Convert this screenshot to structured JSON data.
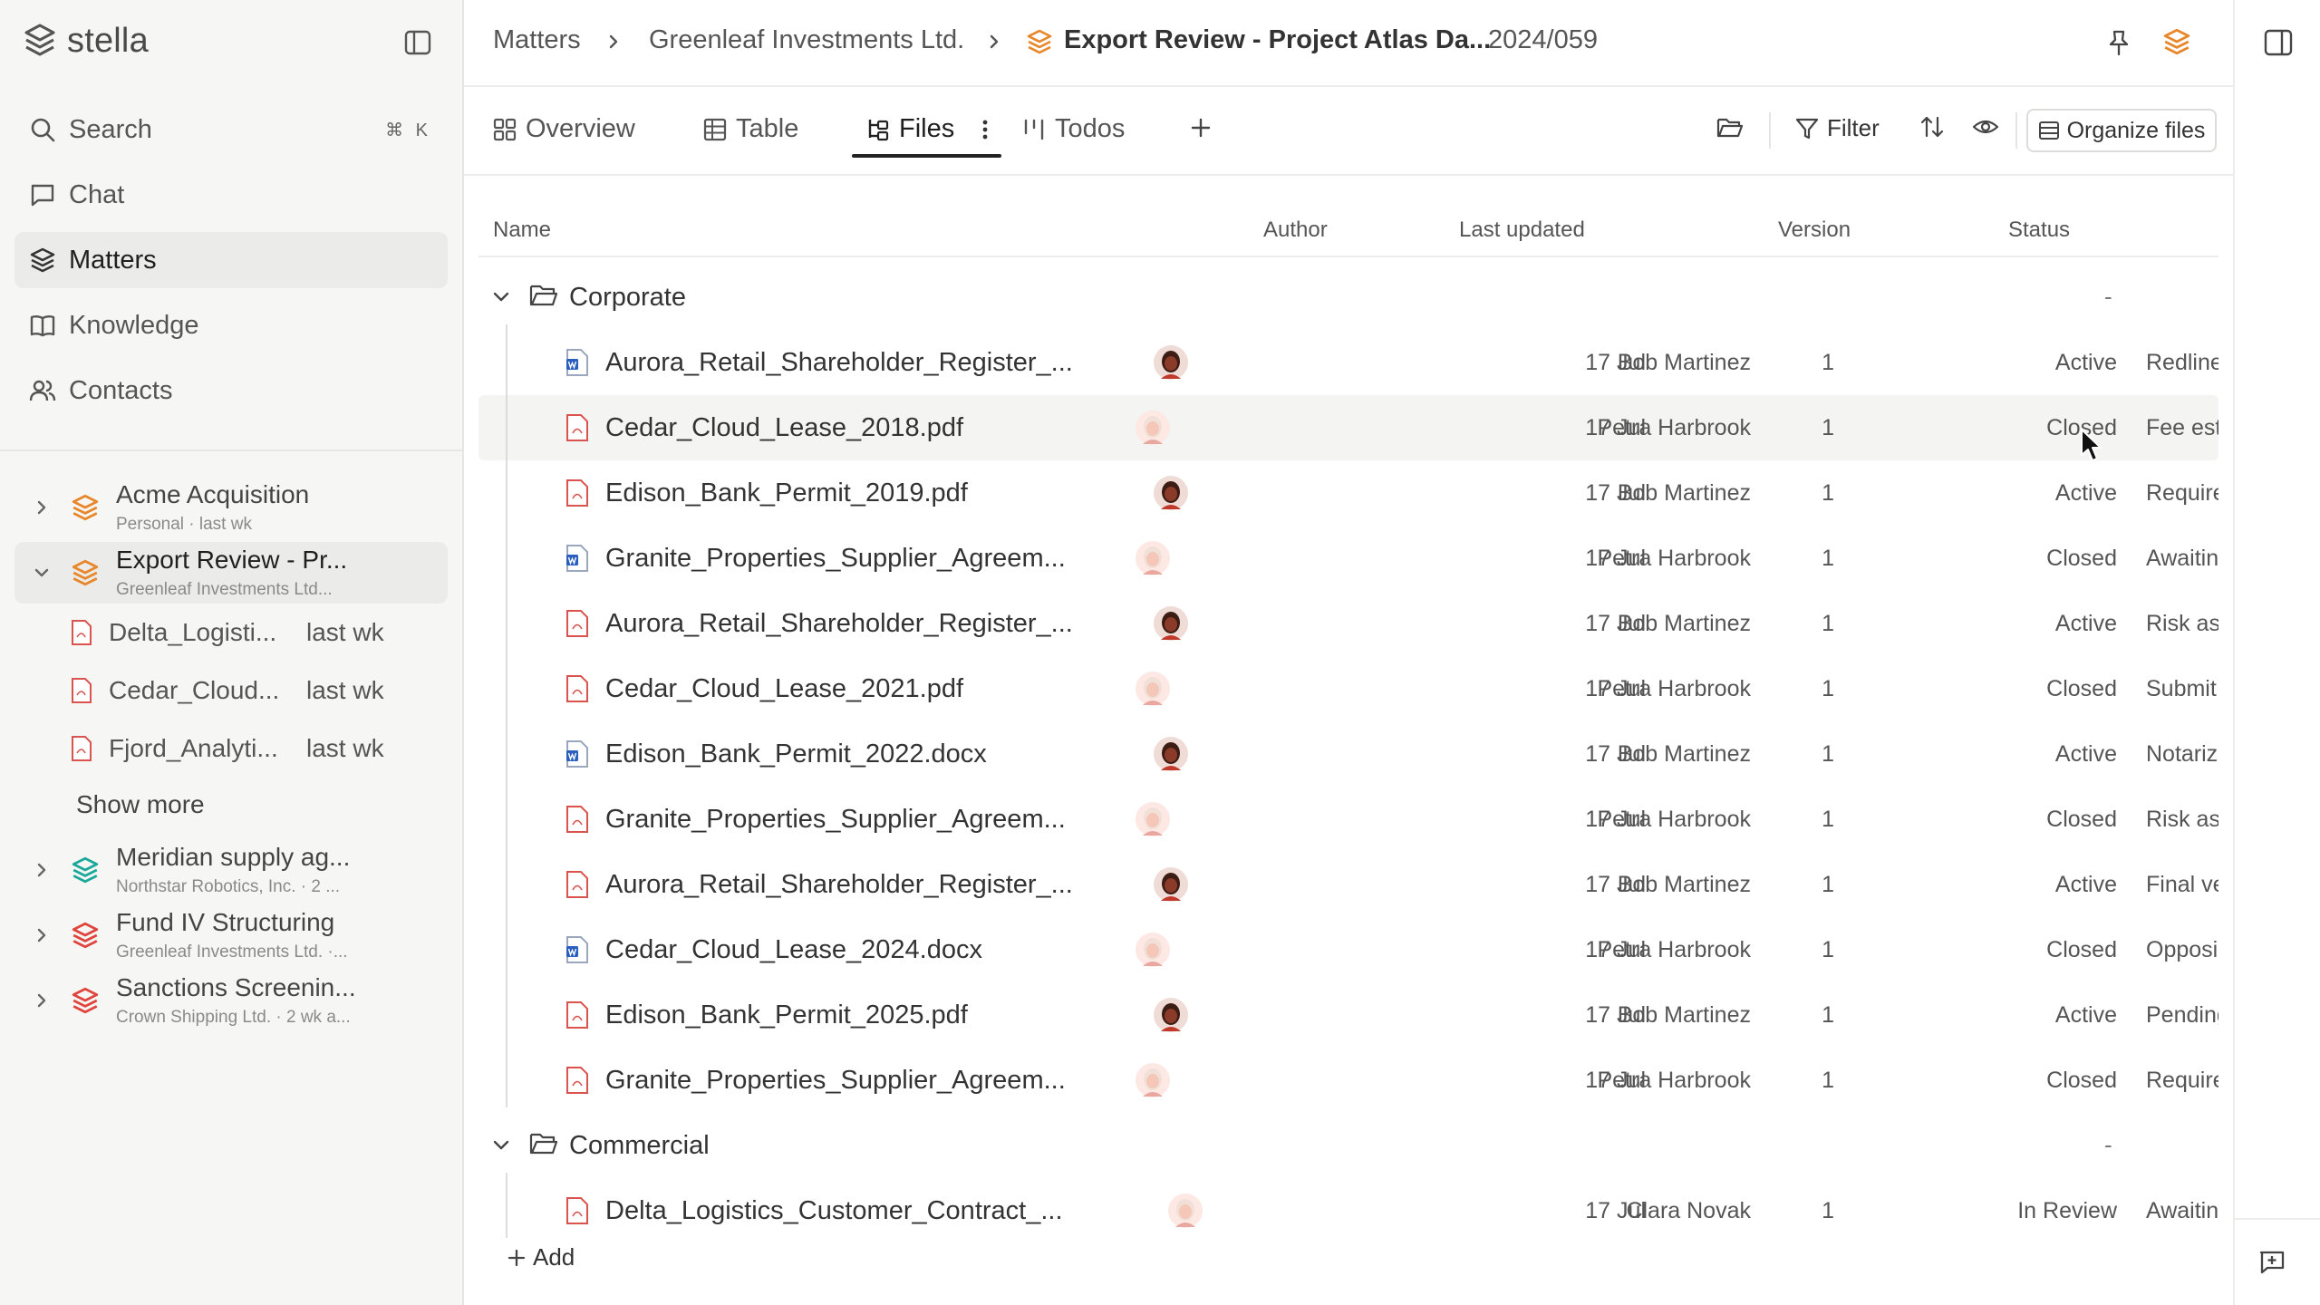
{
  "app": {
    "name": "stella"
  },
  "sidebar": {
    "nav": [
      {
        "label": "Search",
        "shortcut": "⌘ K",
        "icon": "search-icon"
      },
      {
        "label": "Chat",
        "icon": "chat-icon"
      },
      {
        "label": "Matters",
        "icon": "layers-icon"
      },
      {
        "label": "Knowledge",
        "icon": "book-icon"
      },
      {
        "label": "Contacts",
        "icon": "contacts-icon"
      }
    ],
    "matters": [
      {
        "title": "Acme Acquisition",
        "sub": "Personal · last wk",
        "color": "#e8862a"
      },
      {
        "title": "Export Review - Pr...",
        "sub": "Greenleaf Investments Ltd...",
        "color": "#e8862a"
      },
      {
        "title": "Meridian supply ag...",
        "sub": "Northstar Robotics, Inc. · 2 ...",
        "color": "#1aa89a"
      },
      {
        "title": "Fund IV Structuring",
        "sub": "Greenleaf Investments Ltd. ·...",
        "color": "#e0453d"
      },
      {
        "title": "Sanctions Screenin...",
        "sub": "Crown Shipping Ltd. · 2 wk a...",
        "color": "#e0453d"
      }
    ],
    "files": [
      {
        "name": "Delta_Logisti...",
        "time": "last wk"
      },
      {
        "name": "Cedar_Cloud...",
        "time": "last wk"
      },
      {
        "name": "Fjord_Analyti...",
        "time": "last wk"
      }
    ],
    "show_more": "Show more"
  },
  "breadcrumb": {
    "items": [
      "Matters",
      "Greenleaf Investments Ltd."
    ],
    "current": "Export Review - Project Atlas Da...",
    "code": "2024/059"
  },
  "tabs": [
    {
      "label": "Overview",
      "icon": "grid-icon"
    },
    {
      "label": "Table",
      "icon": "table-icon"
    },
    {
      "label": "Files",
      "icon": "files-tree-icon"
    },
    {
      "label": "Todos",
      "icon": "kanban-icon"
    }
  ],
  "toolbar": {
    "filter": "Filter",
    "organize": "Organize files"
  },
  "table": {
    "headers": {
      "name": "Name",
      "author": "Author",
      "updated": "Last updated",
      "version": "Version",
      "status": "Status"
    },
    "groups": [
      {
        "name": "Corporate",
        "dash": "-",
        "rows": [
          {
            "name": "Aurora_Retail_Shareholder_Register_...",
            "type": "doc",
            "author": "Bob Martinez",
            "date": "17 Jul",
            "version": "1",
            "status": "Active",
            "extra": "Redline"
          },
          {
            "name": "Cedar_Cloud_Lease_2018.pdf",
            "type": "pdf",
            "author": "Petra Harbrook",
            "date": "17 Jul",
            "version": "1",
            "status": "Closed",
            "extra": "Fee est"
          },
          {
            "name": "Edison_Bank_Permit_2019.pdf",
            "type": "pdf",
            "author": "Bob Martinez",
            "date": "17 Jul",
            "version": "1",
            "status": "Active",
            "extra": "Require"
          },
          {
            "name": "Granite_Properties_Supplier_Agreem...",
            "type": "doc",
            "author": "Petra Harbrook",
            "date": "17 Jul",
            "version": "1",
            "status": "Closed",
            "extra": "Awaitin"
          },
          {
            "name": "Aurora_Retail_Shareholder_Register_...",
            "type": "pdf",
            "author": "Bob Martinez",
            "date": "17 Jul",
            "version": "1",
            "status": "Active",
            "extra": "Risk as"
          },
          {
            "name": "Cedar_Cloud_Lease_2021.pdf",
            "type": "pdf",
            "author": "Petra Harbrook",
            "date": "17 Jul",
            "version": "1",
            "status": "Closed",
            "extra": "Submit"
          },
          {
            "name": "Edison_Bank_Permit_2022.docx",
            "type": "doc",
            "author": "Bob Martinez",
            "date": "17 Jul",
            "version": "1",
            "status": "Active",
            "extra": "Notariz"
          },
          {
            "name": "Granite_Properties_Supplier_Agreem...",
            "type": "pdf",
            "author": "Petra Harbrook",
            "date": "17 Jul",
            "version": "1",
            "status": "Closed",
            "extra": "Risk as"
          },
          {
            "name": "Aurora_Retail_Shareholder_Register_...",
            "type": "pdf",
            "author": "Bob Martinez",
            "date": "17 Jul",
            "version": "1",
            "status": "Active",
            "extra": "Final ve"
          },
          {
            "name": "Cedar_Cloud_Lease_2024.docx",
            "type": "doc",
            "author": "Petra Harbrook",
            "date": "17 Jul",
            "version": "1",
            "status": "Closed",
            "extra": "Opposi"
          },
          {
            "name": "Edison_Bank_Permit_2025.pdf",
            "type": "pdf",
            "author": "Bob Martinez",
            "date": "17 Jul",
            "version": "1",
            "status": "Active",
            "extra": "Pending"
          },
          {
            "name": "Granite_Properties_Supplier_Agreem...",
            "type": "pdf",
            "author": "Petra Harbrook",
            "date": "17 Jul",
            "version": "1",
            "status": "Closed",
            "extra": "Require"
          }
        ]
      },
      {
        "name": "Commercial",
        "dash": "-",
        "rows": [
          {
            "name": "Delta_Logistics_Customer_Contract_...",
            "type": "pdf",
            "author": "Clara Novak",
            "date": "17 Jul",
            "version": "1",
            "status": "In Review",
            "extra": "Awaitin"
          }
        ]
      }
    ],
    "add_label": "Add"
  },
  "colors": {
    "accent": "#e8862a",
    "pdf": "#d9534f",
    "word": "#2b5fbf"
  }
}
